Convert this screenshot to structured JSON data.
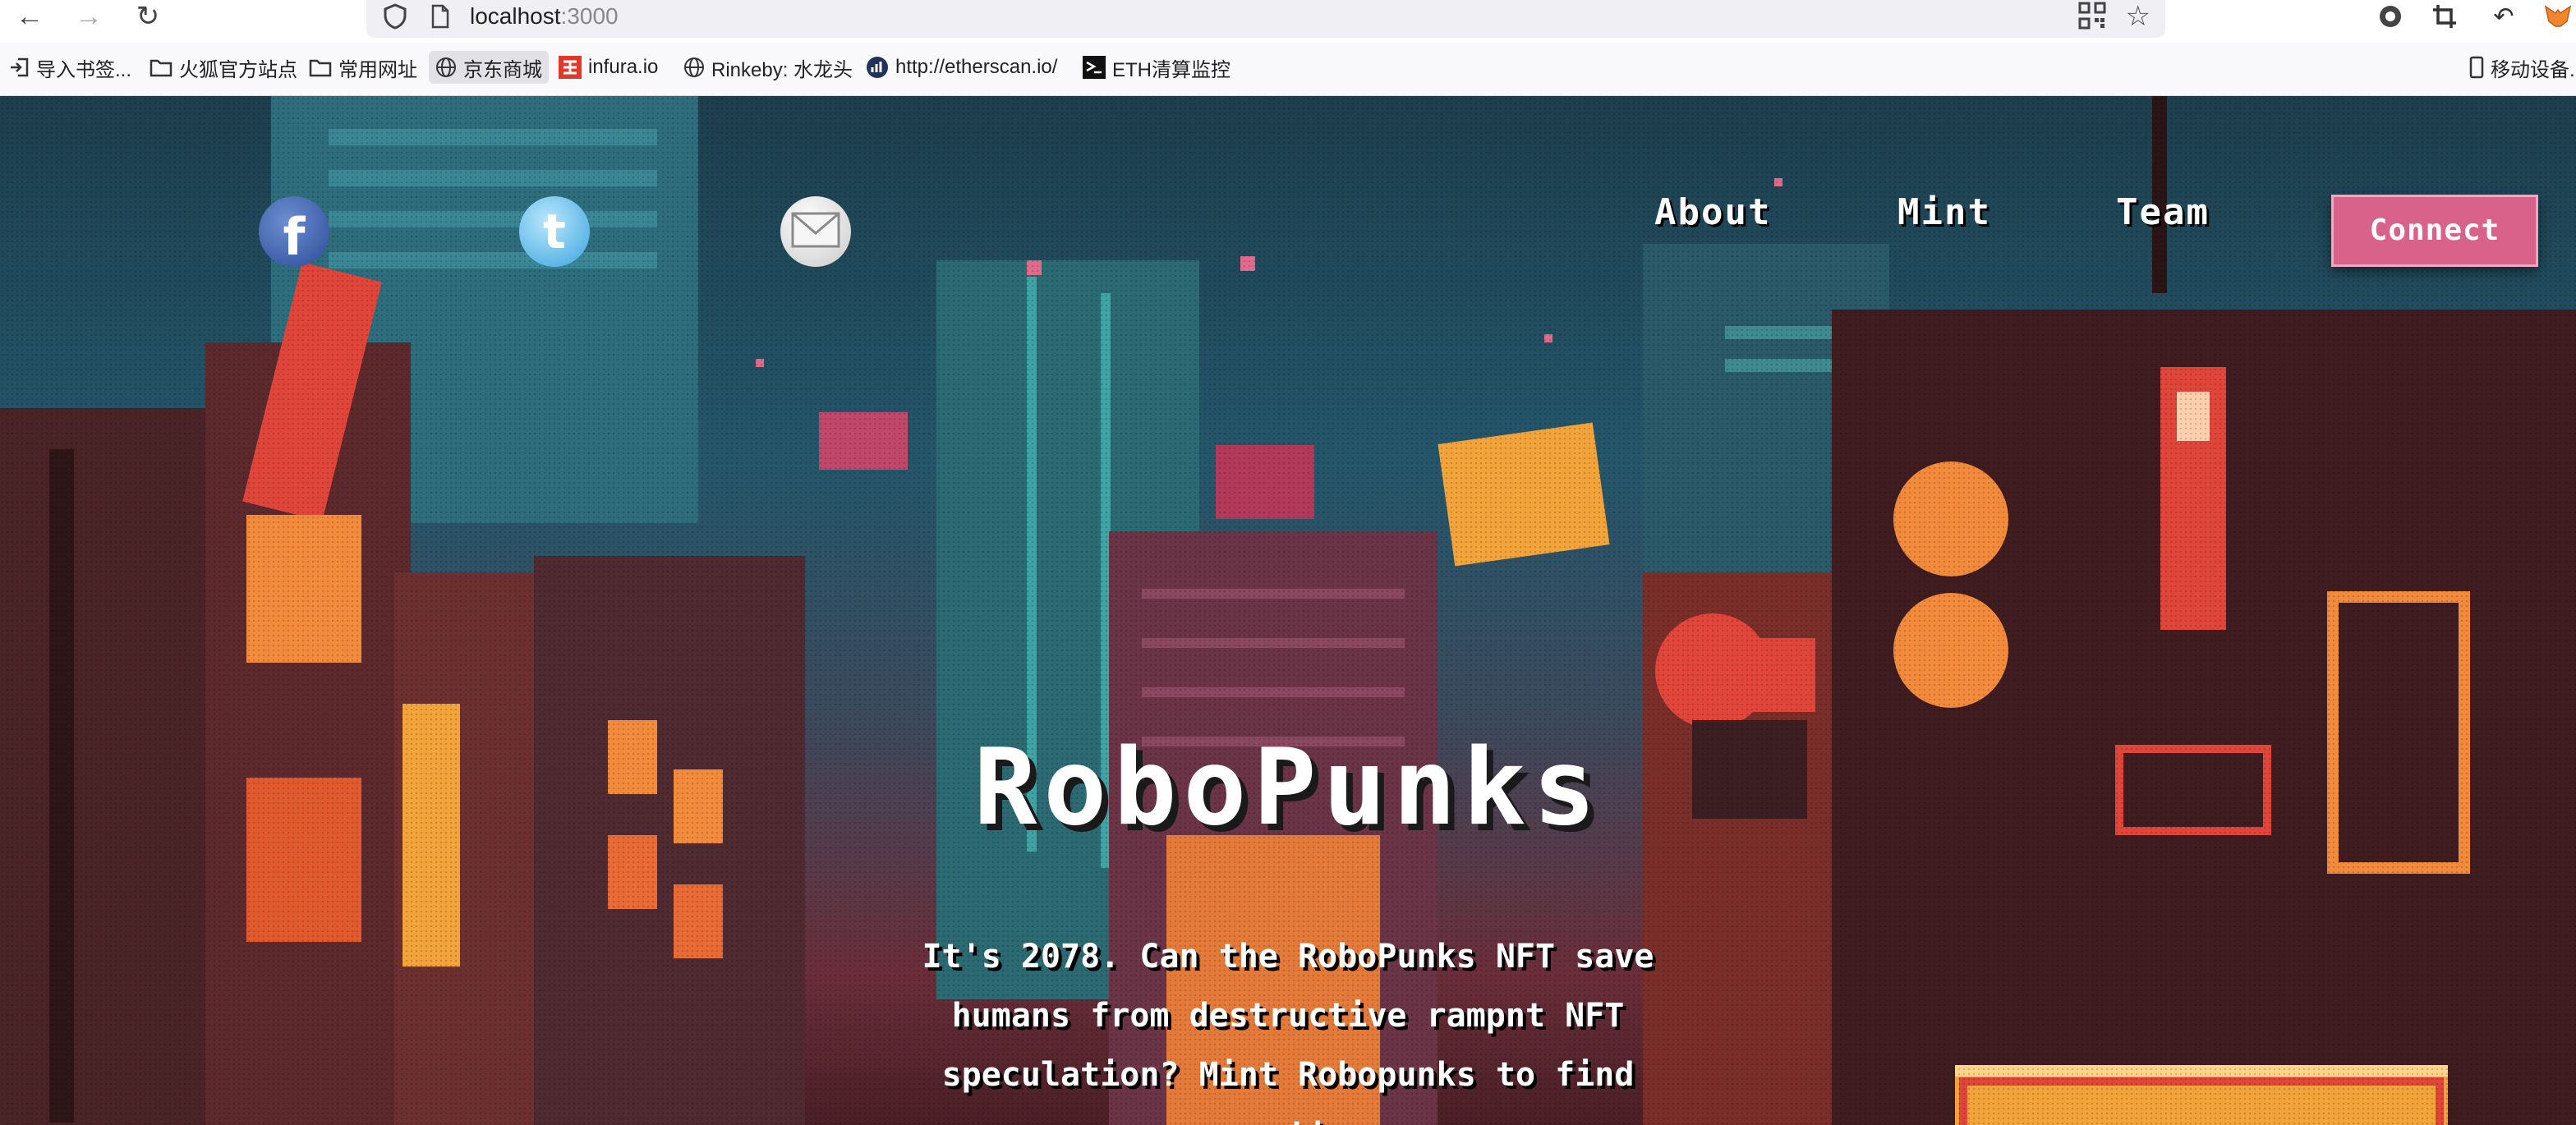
{
  "browser": {
    "url_host": "localhost",
    "url_port": ":3000",
    "bookmarks": [
      {
        "label": "导入书签...",
        "icon": "import-icon"
      },
      {
        "label": "火狐官方站点",
        "icon": "folder-icon"
      },
      {
        "label": "常用网址",
        "icon": "folder-icon"
      },
      {
        "label": "京东商城",
        "icon": "globe-icon"
      },
      {
        "label": "infura.io",
        "icon": "infura-icon"
      },
      {
        "label": "Rinkeby: 水龙头",
        "icon": "globe-icon"
      },
      {
        "label": "http://etherscan.io/",
        "icon": "etherscan-icon"
      },
      {
        "label": "ETH清算监控",
        "icon": "terminal-icon"
      }
    ],
    "mobile_bookmarks": "移动设备..."
  },
  "site": {
    "social": [
      {
        "name": "facebook",
        "icon": "facebook-icon",
        "glyph": "f"
      },
      {
        "name": "twitter",
        "icon": "twitter-icon",
        "glyph": "t"
      },
      {
        "name": "email",
        "icon": "mail-icon",
        "glyph": "✉"
      }
    ],
    "nav": {
      "about": "About",
      "mint": "Mint",
      "team": "Team",
      "connect": "Connect"
    },
    "hero": {
      "title": "RoboPunks",
      "description_lines": [
        "It's 2078. Can the RoboPunks NFT save",
        "humans from destructive rampnt NFT",
        "speculation? Mint Robopunks to find out!"
      ]
    },
    "colors": {
      "connect_button": "#d8628a",
      "sky": "#24566a",
      "neon_orange": "#f28a3c",
      "neon_red": "#e0453a"
    }
  }
}
